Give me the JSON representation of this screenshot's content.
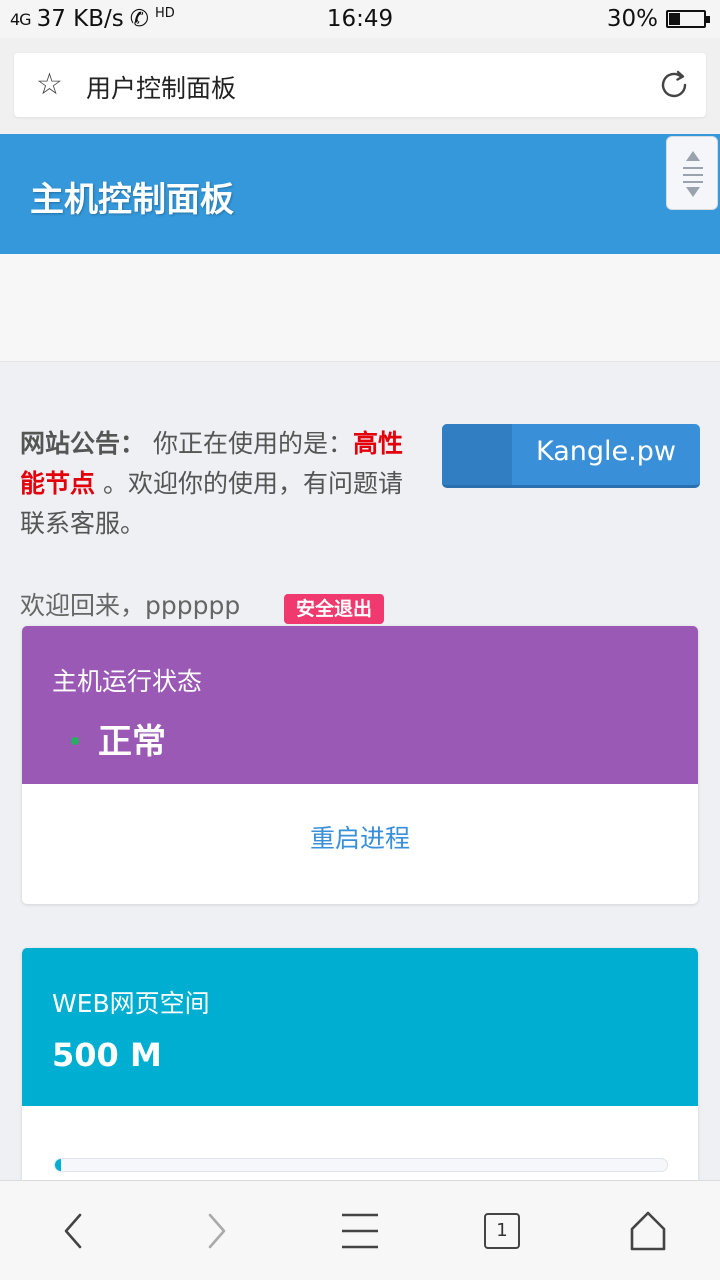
{
  "status_bar": {
    "signal": "4G",
    "speed": "37 KB/s",
    "hd": "HD",
    "time": "16:49",
    "battery": "30%",
    "battery_level": 0.3
  },
  "browser": {
    "page_title": "用户控制面板",
    "tab_count": "1"
  },
  "header": {
    "title": "主机控制面板"
  },
  "notice": {
    "label": "网站公告：",
    "text_before": "你正在使用的是：",
    "highlight": "高性能节点",
    "text_after": "。欢迎你的使用，有问题请联系客服。"
  },
  "brand_button": {
    "label": "Kangle.pw"
  },
  "welcome": {
    "text": "欢迎回来，pppppp",
    "logout_label": "安全退出"
  },
  "host_status_card": {
    "title": "主机运行状态",
    "value": "正常",
    "action_label": "重启进程",
    "color": "#9b59b6",
    "status_color": "#27ae60"
  },
  "web_space_card": {
    "title": "WEB网页空间",
    "value": "500 M",
    "usage_fraction": 0.01,
    "color": "#00aed1"
  },
  "colors": {
    "header": "#3498db",
    "accent_link": "#3a8fd9",
    "logout_badge": "#f0396e",
    "highlight": "#e3000b"
  },
  "icons": {
    "url_bar": [
      "star-icon",
      "refresh-icon"
    ],
    "bottom_nav": [
      "back-icon",
      "forward-icon",
      "menu-icon",
      "tabs-icon",
      "home-icon"
    ]
  }
}
